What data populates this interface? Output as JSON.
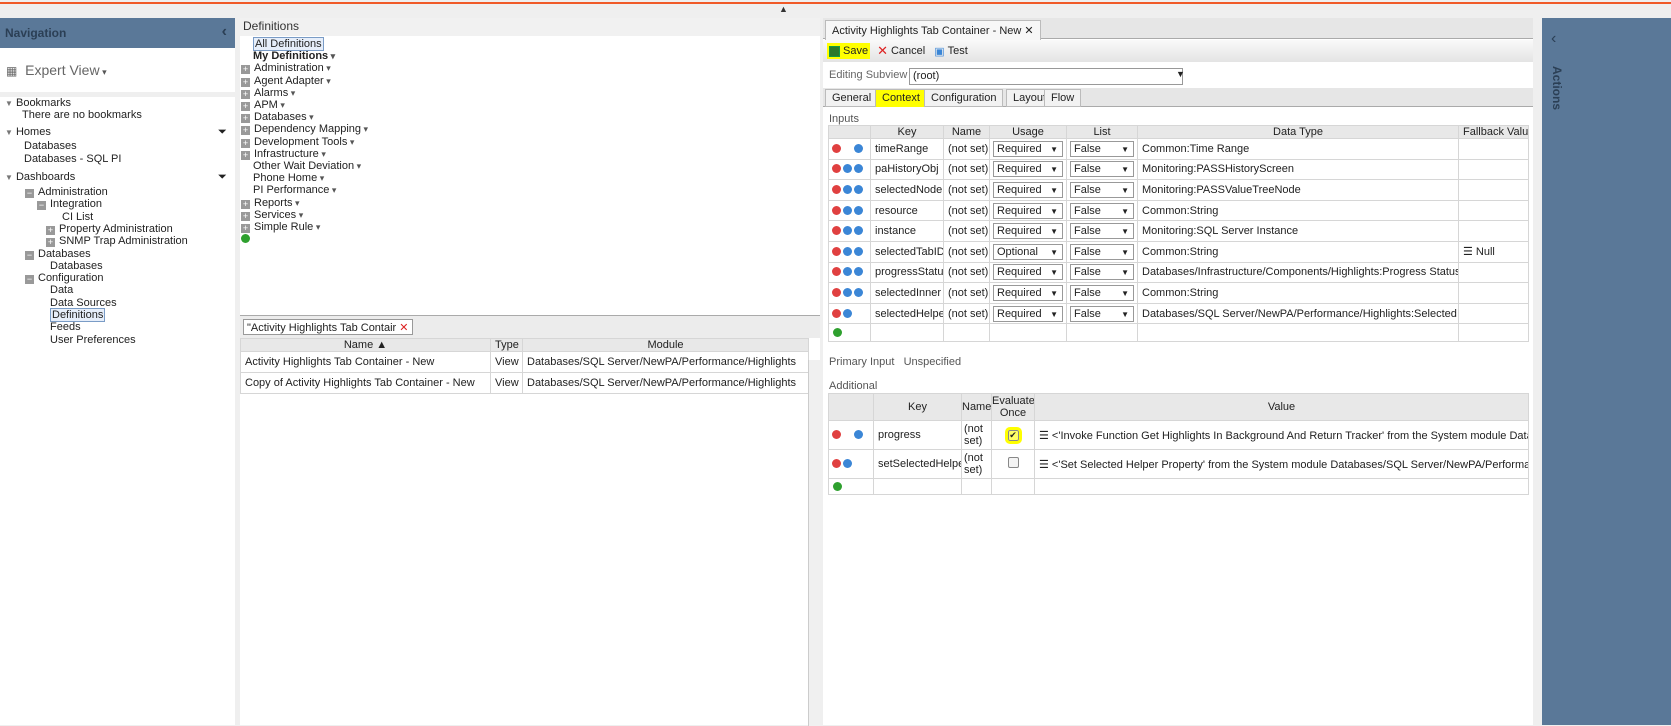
{
  "navigation": {
    "title": "Navigation",
    "view": "Expert View",
    "bookmarks": {
      "label": "Bookmarks",
      "empty": "There are no bookmarks"
    },
    "homes": {
      "label": "Homes",
      "items": [
        "Databases",
        "Databases - SQL PI"
      ]
    },
    "dashboards": {
      "label": "Dashboards",
      "items": [
        "Administration",
        "Integration",
        "CI List",
        "Property Administration",
        "SNMP Trap Administration",
        "Databases",
        "Databases",
        "Configuration",
        "Data",
        "Data Sources",
        "Definitions",
        "Feeds",
        "User Preferences"
      ]
    }
  },
  "definitions": {
    "title": "Definitions",
    "items": [
      "All Definitions",
      "My Definitions",
      "Administration",
      "Agent Adapter",
      "Alarms",
      "APM",
      "Databases",
      "Dependency Mapping",
      "Development Tools",
      "Infrastructure",
      "Other Wait Deviation",
      "Phone Home",
      "PI Performance",
      "Reports",
      "Services",
      "Simple Rule"
    ]
  },
  "search": {
    "chip": "\"Activity Highlights Tab Contair",
    "columns": [
      "Name ▲",
      "Type",
      "Module"
    ],
    "rows": [
      [
        "Activity Highlights Tab Container - New",
        "View",
        "Databases/SQL Server/NewPA/Performance/Highlights"
      ],
      [
        "Copy of Activity Highlights Tab Container - New",
        "View",
        "Databases/SQL Server/NewPA/Performance/Highlights"
      ]
    ]
  },
  "editor": {
    "tab": "Activity Highlights Tab Container - New",
    "save": "Save",
    "cancel": "Cancel",
    "test": "Test",
    "subview_label": "Editing Subview",
    "subview_value": "(root)",
    "tabs": [
      "General",
      "Context",
      "Configuration",
      "Layout",
      "Flow"
    ],
    "active_tab": "Context",
    "inputs_label": "Inputs",
    "inputs_columns": [
      "",
      "Key",
      "Name",
      "Usage",
      "List",
      "Data Type",
      "Fallback Value"
    ],
    "inputs": [
      {
        "key": "timeRange",
        "name": "(not set)",
        "usage": "Required",
        "list": "False",
        "type": "Common:Time Range",
        "fallback": ""
      },
      {
        "key": "paHistoryObj",
        "name": "(not set)",
        "usage": "Required",
        "list": "False",
        "type": "Monitoring:PASSHistoryScreen",
        "fallback": ""
      },
      {
        "key": "selectedNode",
        "name": "(not set)",
        "usage": "Required",
        "list": "False",
        "type": "Monitoring:PASSValueTreeNode",
        "fallback": ""
      },
      {
        "key": "resource",
        "name": "(not set)",
        "usage": "Required",
        "list": "False",
        "type": "Common:String",
        "fallback": ""
      },
      {
        "key": "instance",
        "name": "(not set)",
        "usage": "Required",
        "list": "False",
        "type": "Monitoring:SQL Server Instance",
        "fallback": ""
      },
      {
        "key": "selectedTabID",
        "name": "(not set)",
        "usage": "Optional",
        "list": "False",
        "type": "Common:String",
        "fallback": "Null"
      },
      {
        "key": "progressStatus",
        "name": "(not set)",
        "usage": "Required",
        "list": "False",
        "type": "Databases/Infrastructure/Components/Highlights:Progress Status",
        "fallback": ""
      },
      {
        "key": "selectedInner",
        "name": "(not set)",
        "usage": "Required",
        "list": "False",
        "type": "Common:String",
        "fallback": ""
      },
      {
        "key": "selectedHelper",
        "name": "(not set)",
        "usage": "Required",
        "list": "False",
        "type": "Databases/SQL Server/NewPA/Performance/Highlights:Selected Helper",
        "fallback": ""
      }
    ],
    "primary_label": "Primary Input",
    "primary_value": "Unspecified",
    "additional_label": "Additional",
    "additional_columns": [
      "",
      "Key",
      "Name",
      "Evaluate Once",
      "Value"
    ],
    "additional": [
      {
        "key": "progress",
        "name": "(not set)",
        "once": true,
        "value": "<'Invoke Function Get Highlights In Background And Return Tracker' from the System module Databases/I"
      },
      {
        "key": "setSelectedHelper",
        "name": "(not set)",
        "once": false,
        "value": "<'Set Selected Helper Property' from the System module Databases/SQL Server/NewPA/Performance/Highl"
      }
    ]
  },
  "actions": {
    "label": "Actions"
  },
  "colors": {
    "accent": "#f05a28",
    "panel": "#5a7898",
    "highlight": "#ffff00"
  }
}
